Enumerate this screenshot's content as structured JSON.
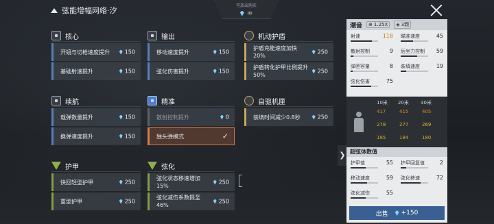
{
  "header": {
    "title": "弦能增幅网络·汐",
    "buy_label": "可放出购买",
    "buy_value": "∞"
  },
  "groups": [
    {
      "name": "核心",
      "icon": "core-icon",
      "rows": [
        {
          "label": "开镜与切枪速度提升",
          "cost": "150"
        },
        {
          "label": "基础射速提升",
          "cost": "150"
        }
      ]
    },
    {
      "name": "输出",
      "icon": "output-icon",
      "rows": [
        {
          "label": "移动速度提升",
          "cost": "150"
        },
        {
          "label": "弦化伤害提升",
          "cost": "150"
        }
      ]
    },
    {
      "name": "机动护盾",
      "icon": "shield-icon",
      "rows": [
        {
          "label": "护盾充能速度加快20%",
          "cost": "250"
        },
        {
          "label": "护盾转化护甲比例提升50%",
          "cost": "250"
        }
      ]
    },
    {
      "name": "续航",
      "icon": "endurance-icon",
      "rows": [
        {
          "label": "载弹数量提升",
          "cost": "150"
        },
        {
          "label": "换弹速度提升",
          "cost": "150"
        }
      ]
    },
    {
      "name": "精准",
      "icon": "precision-icon",
      "rows": [
        {
          "label": "散射控制提升",
          "cost": "0"
        },
        {
          "label": "独头弹模式",
          "cost": ""
        }
      ]
    },
    {
      "name": "自驱机匣",
      "icon": "receiver-icon",
      "rows": [
        {
          "label": "装填时间减少0.8秒",
          "cost": "250"
        }
      ]
    },
    {
      "name": "护甲",
      "icon": "armor-icon",
      "rows": [
        {
          "label": "快回轻型护甲",
          "cost": "250"
        },
        {
          "label": "重型护甲",
          "cost": "250"
        }
      ]
    },
    {
      "name": "弦化",
      "icon": "string-icon",
      "rows": [
        {
          "label": "弦化状态移速增加15%",
          "cost": "250"
        },
        {
          "label": "弦化减伤系数提至46%",
          "cost": "250"
        }
      ]
    }
  ],
  "panel": {
    "name": "潮音",
    "scope": "1.25X",
    "slots": "3颗",
    "stats": [
      {
        "label": "射速",
        "value": "118",
        "pct": 0.78,
        "orange": true
      },
      {
        "label": "瞄准速度",
        "value": "45",
        "pct": 0.45
      },
      {
        "label": "散射控制",
        "value": "9",
        "pct": 0.1
      },
      {
        "label": "后坐力控制",
        "value": "59",
        "pct": 0.59
      },
      {
        "label": "弹匣容量",
        "value": "8",
        "pct": 0.08
      },
      {
        "label": "装填速度",
        "value": "19",
        "pct": 0.19
      },
      {
        "label": "弦化伤害",
        "value": "75",
        "pct": 0.75
      }
    ],
    "distance": {
      "headers": [
        "10米",
        "20米",
        "30米"
      ],
      "rows": [
        {
          "values": [
            "417",
            "415",
            "405"
          ],
          "color": "#d6892b"
        },
        {
          "values": [
            "278",
            "277",
            "269"
          ],
          "color": "#e0b02f"
        },
        {
          "values": [
            "185",
            "184",
            "180"
          ],
          "color": "#d9a42e"
        }
      ]
    },
    "super_title": "超弦体数值",
    "super_stats": [
      {
        "label": "护甲值",
        "value": "55",
        "pct": 0.55
      },
      {
        "label": "护甲回复值",
        "value": "2",
        "pct": 0.2
      },
      {
        "label": "移动速度",
        "value": "59",
        "pct": 0.59
      },
      {
        "label": "弦化移速",
        "value": "72",
        "pct": 0.72
      },
      {
        "label": "弦化减伤",
        "value": "55",
        "pct": 0.55
      }
    ],
    "sell_label": "出售",
    "sell_price": "+150"
  },
  "colors": {
    "accent_blue": "#5a7fb8",
    "gold": "#c9a45a",
    "green": "#7f9e45",
    "selected": "#d27a4e",
    "orange": "#d07b1e"
  }
}
